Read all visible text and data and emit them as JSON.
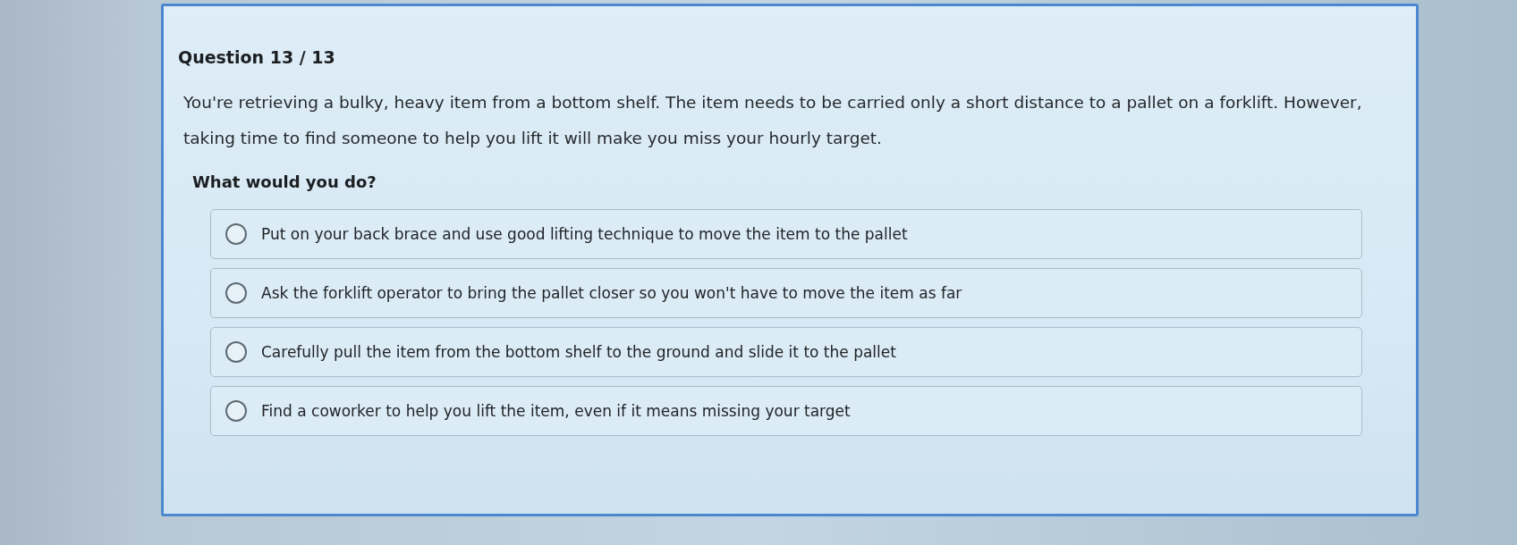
{
  "question": {
    "counter": "Question 13 / 13",
    "text": "You're retrieving a bulky, heavy item from a bottom shelf. The item needs to be carried only a short distance to a pallet on a forklift. However, taking time to find someone to help you lift it will make you miss your hourly target.",
    "prompt": "What would you do?"
  },
  "options": [
    {
      "label": "Put on your back brace and use good lifting technique to move the item to the pallet",
      "selected": false
    },
    {
      "label": "Ask the forklift operator to bring the pallet closer so you won't have to move the item as far",
      "selected": false
    },
    {
      "label": "Carefully pull the item from the bottom shelf to the ground and slide it to the pallet",
      "selected": false
    },
    {
      "label": "Find a coworker to help you lift the item, even if it means missing your target",
      "selected": false
    }
  ]
}
